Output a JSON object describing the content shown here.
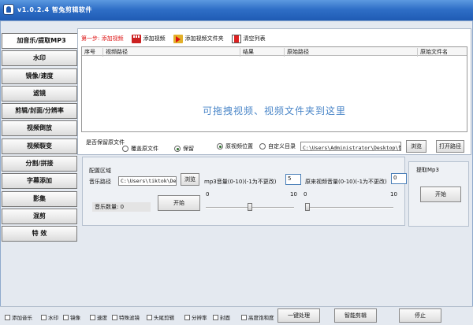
{
  "window": {
    "title": "v1.0.2.4 智兔剪辑软件"
  },
  "sidebar": {
    "items": [
      {
        "label": "加音乐/提取MP3"
      },
      {
        "label": "水印"
      },
      {
        "label": "镜像/速度"
      },
      {
        "label": "滤镜"
      },
      {
        "label": "剪辑/封面/分辨率"
      },
      {
        "label": "视频倒放"
      },
      {
        "label": "视频裂变"
      },
      {
        "label": "分割/拼接"
      },
      {
        "label": "字幕添加"
      },
      {
        "label": "影集"
      },
      {
        "label": "混剪"
      },
      {
        "label": "特 效"
      }
    ]
  },
  "toolbar": {
    "step": "第一步: 添加视频",
    "add_video": "添加视频",
    "add_folder": "添加视频文件夹",
    "clear_list": "清空列表"
  },
  "table": {
    "columns": [
      "序号",
      "视频路径",
      "结果",
      "原始路径",
      "原始文件名"
    ],
    "hint": "可拖拽视频、视频文件夹到这里"
  },
  "output": {
    "keep_original_label": "是否保留原文件",
    "overwrite_label": "覆盖原文件",
    "keep_label": "保留",
    "orig_location_label": "原视频位置",
    "custom_dir_label": "自定义目录",
    "path": "C:\\Users\\Administrator\\Desktop\\智兔剪",
    "browse": "浏览",
    "open_path": "打开路径"
  },
  "config": {
    "section_label": "配置区域",
    "music_path_label": "音乐路径",
    "music_path": "C:\\Users\\tiktok\\Deskt",
    "browse": "浏览",
    "music_count_label": "音乐数量: 0",
    "start": "开始",
    "mp3_volume_label": "mp3音量(0-10)(-1为不更改)",
    "mp3_volume": "5",
    "orig_volume_label": "原来视频音量(0-10)(-1为不更改)",
    "orig_volume": "0",
    "slider_min": "0",
    "slider_max": "10",
    "mp3_slider_level": 0.5,
    "orig_slider_level": 0.0
  },
  "extract": {
    "title": "提取Mp3",
    "start": "开始"
  },
  "bottom": {
    "checks": [
      "添加音乐",
      "水印",
      "镜像",
      "速度",
      "特殊滤镜",
      "头尾剪辑",
      "分辨率",
      "封面",
      "高度饱和度"
    ],
    "one_key": "一键处理",
    "smart": "智能剪辑",
    "stop": "停止"
  }
}
